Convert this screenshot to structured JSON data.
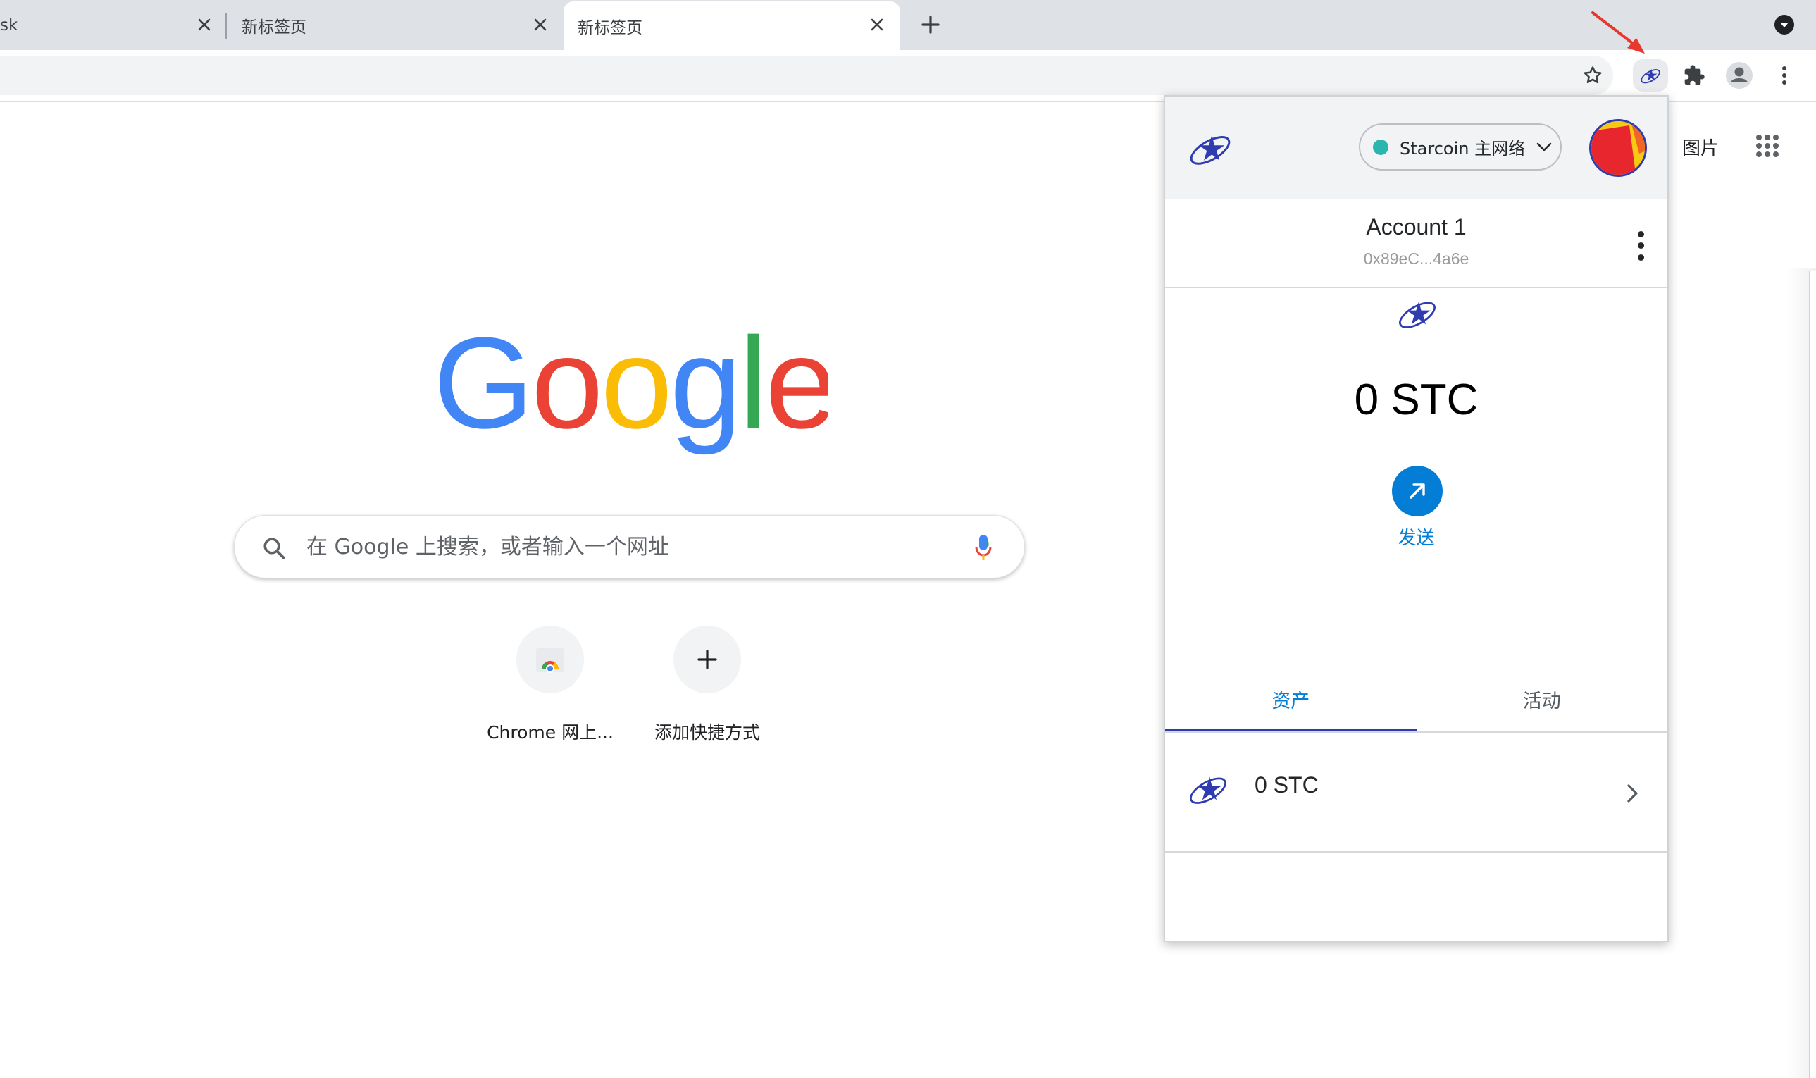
{
  "browser": {
    "tabs": [
      {
        "title": "sk",
        "active": false
      },
      {
        "title": "新标签页",
        "active": false
      },
      {
        "title": "新标签页",
        "active": true
      }
    ],
    "new_tab_symbol": "+"
  },
  "icons": {
    "star": "star-icon",
    "extension": "starmask-extension-icon",
    "puzzle": "extensions-puzzle-icon",
    "profile": "profile-icon",
    "menu": "chrome-menu-icon",
    "annotation": "red-arrow-annotation"
  },
  "ntp": {
    "images_link": "图片",
    "search_placeholder": "在 Google 上搜索，或者输入一个网址",
    "shortcuts": [
      {
        "label": "Chrome 网上..."
      },
      {
        "label": "添加快捷方式"
      }
    ]
  },
  "wallet": {
    "network": "Starcoin 主网络",
    "network_status_color": "#29b6af",
    "account_name": "Account 1",
    "account_address": "0x89eC...4a6e",
    "balance": "0 STC",
    "send_label": "发送",
    "tabs": [
      {
        "label": "资产",
        "active": true
      },
      {
        "label": "活动",
        "active": false
      }
    ],
    "assets": [
      {
        "amount": "0 STC"
      }
    ],
    "accent_color": "#037dd6",
    "brand_color": "#2f3cb0"
  }
}
